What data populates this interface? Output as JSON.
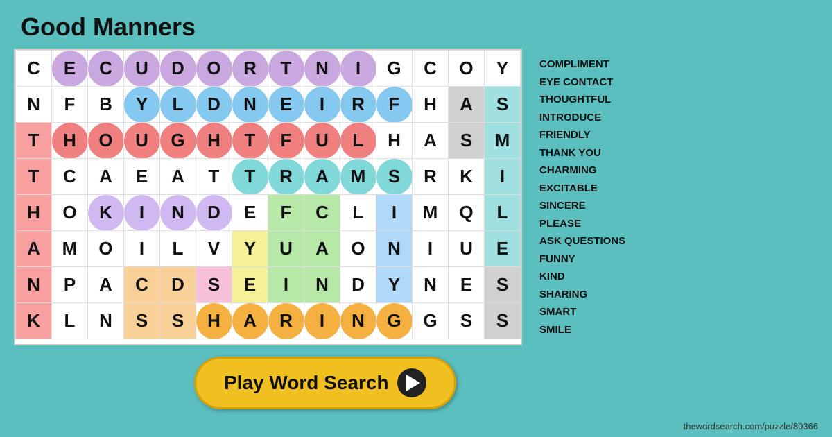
{
  "title": "Good Manners",
  "website": "thewordsearch.com/puzzle/80366",
  "play_button": {
    "label": "Play Word Search"
  },
  "word_list": [
    "COMPLIMENT",
    "EYE CONTACT",
    "THOUGHTFUL",
    "INTRODUCE",
    "FRIENDLY",
    "THANK YOU",
    "CHARMING",
    "EXCITABLE",
    "SINCERE",
    "PLEASE",
    "ASK QUESTIONS",
    "FUNNY",
    "KIND",
    "SHARING",
    "SMART",
    "SMILE"
  ],
  "grid": [
    [
      "C",
      "E",
      "C",
      "U",
      "D",
      "O",
      "R",
      "T",
      "N",
      "I",
      "G",
      "C",
      "O",
      "Y"
    ],
    [
      "N",
      "F",
      "B",
      "Y",
      "L",
      "D",
      "N",
      "E",
      "I",
      "R",
      "F",
      "H",
      "A",
      "S"
    ],
    [
      "T",
      "H",
      "O",
      "U",
      "G",
      "H",
      "T",
      "F",
      "U",
      "L",
      "H",
      "A",
      "S",
      "M"
    ],
    [
      "T",
      "C",
      "A",
      "E",
      "A",
      "T",
      "T",
      "R",
      "A",
      "M",
      "S",
      "R",
      "K",
      "I"
    ],
    [
      "H",
      "O",
      "K",
      "I",
      "N",
      "D",
      "E",
      "F",
      "C",
      "L",
      "I",
      "M",
      "Q",
      "L"
    ],
    [
      "A",
      "M",
      "O",
      "I",
      "L",
      "V",
      "Y",
      "U",
      "A",
      "O",
      "N",
      "I",
      "U",
      "E"
    ],
    [
      "N",
      "P",
      "A",
      "C",
      "D",
      "S",
      "E",
      "I",
      "N",
      "D",
      "Y",
      "N",
      "E",
      "S"
    ],
    [
      "K",
      "L",
      "N",
      "S",
      "S",
      "H",
      "A",
      "R",
      "I",
      "N",
      "G",
      "G",
      "S",
      "S"
    ]
  ]
}
